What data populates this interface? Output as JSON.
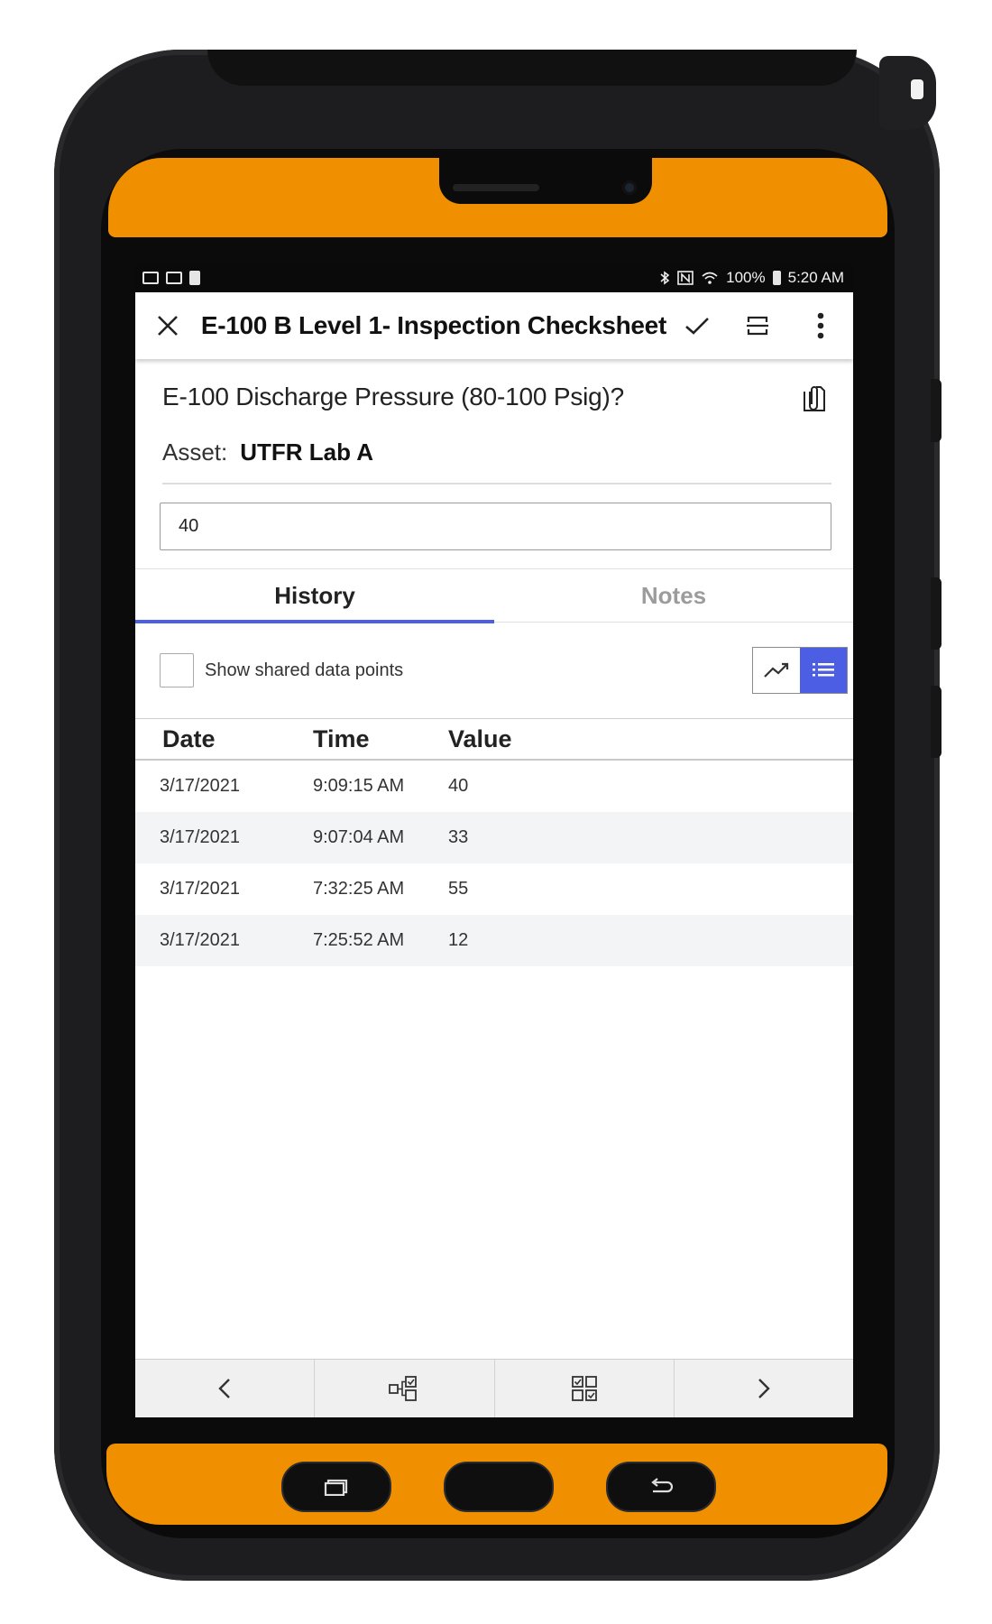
{
  "status_bar": {
    "battery": "100%",
    "time": "5:20 AM"
  },
  "app_bar": {
    "title": "E-100 B Level 1- Inspection Checksheet"
  },
  "question": {
    "text": "E-100 Discharge Pressure (80-100 Psig)?",
    "asset_label": "Asset:",
    "asset_value": "UTFR Lab A"
  },
  "reading_input": {
    "value": "40"
  },
  "tabs": [
    {
      "label": "History",
      "active": true
    },
    {
      "label": "Notes",
      "active": false
    }
  ],
  "options": {
    "show_shared_label": "Show shared data points",
    "show_shared_checked": false
  },
  "history_table": {
    "headers": {
      "date": "Date",
      "time": "Time",
      "value": "Value"
    },
    "rows": [
      {
        "date": "3/17/2021",
        "time": "9:09:15 AM",
        "value": "40"
      },
      {
        "date": "3/17/2021",
        "time": "9:07:04 AM",
        "value": "33"
      },
      {
        "date": "3/17/2021",
        "time": "7:32:25 AM",
        "value": "55"
      },
      {
        "date": "3/17/2021",
        "time": "7:25:52 AM",
        "value": "12"
      }
    ]
  },
  "colors": {
    "accent": "#4b5ee4",
    "device_orange": "#f08f00",
    "device_body": "#1d1d1f"
  },
  "icons": {
    "close": "close-icon",
    "complete": "checkmark-icon",
    "scan": "scan-icon",
    "more": "more-vertical-icon",
    "attach": "paperclip-icon",
    "chart_view": "trend-chart-icon",
    "list_view": "list-icon",
    "prev": "chevron-left-icon",
    "tasks": "task-flow-icon",
    "overview": "grid-check-icon",
    "next": "chevron-right-icon"
  }
}
